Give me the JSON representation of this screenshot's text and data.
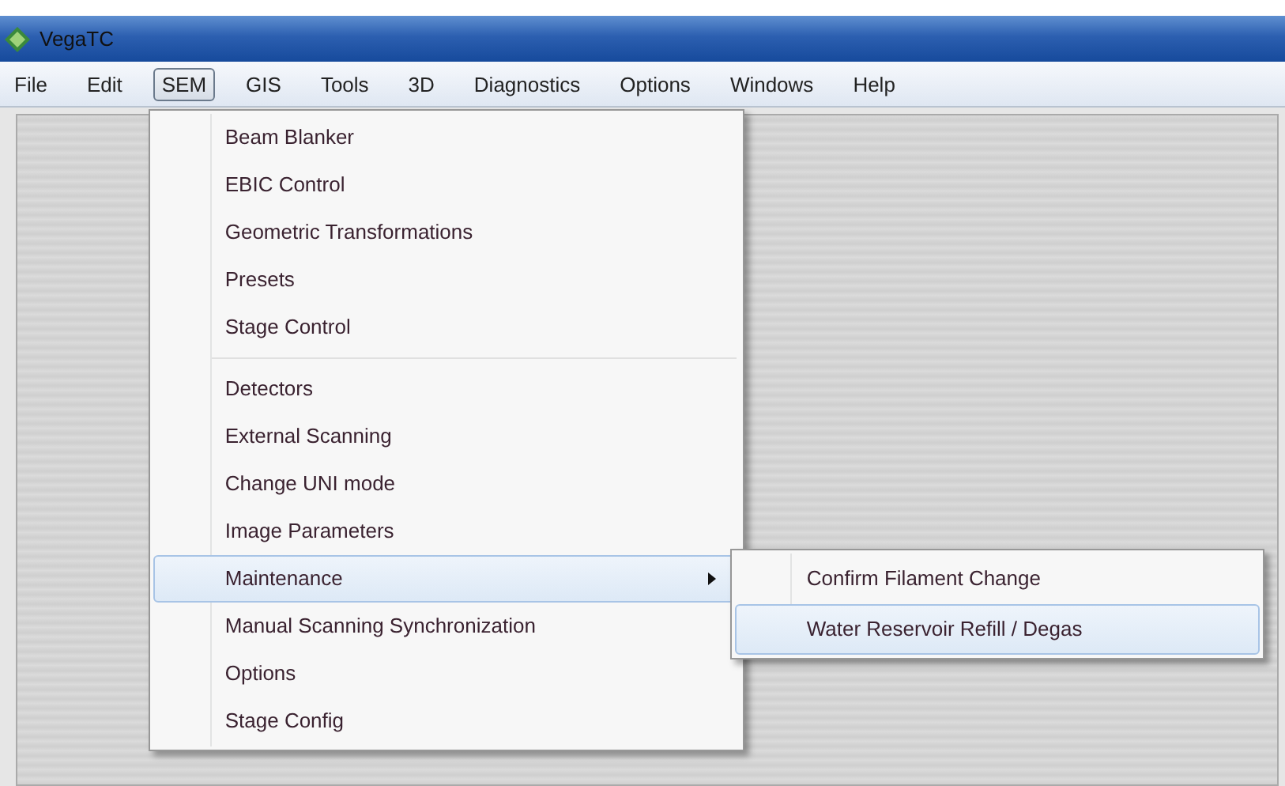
{
  "window": {
    "title": "VegaTC"
  },
  "menu_bar": [
    {
      "label": "File",
      "selected": false
    },
    {
      "label": "Edit",
      "selected": false
    },
    {
      "label": "SEM",
      "selected": true
    },
    {
      "label": "GIS",
      "selected": false
    },
    {
      "label": "Tools",
      "selected": false
    },
    {
      "label": "3D",
      "selected": false
    },
    {
      "label": "Diagnostics",
      "selected": false
    },
    {
      "label": "Options",
      "selected": false
    },
    {
      "label": "Windows",
      "selected": false
    },
    {
      "label": "Help",
      "selected": false
    }
  ],
  "dropdown": {
    "groups": [
      [
        {
          "label": "Beam Blanker",
          "selected": false
        },
        {
          "label": "EBIC Control",
          "selected": false
        },
        {
          "label": "Geometric Transformations",
          "selected": false
        },
        {
          "label": "Presets",
          "selected": false
        },
        {
          "label": "Stage Control",
          "selected": false
        }
      ],
      [
        {
          "label": "Detectors",
          "selected": false
        },
        {
          "label": "External Scanning",
          "selected": false
        },
        {
          "label": "Change UNI mode",
          "selected": false
        },
        {
          "label": "Image Parameters",
          "selected": false
        },
        {
          "label": "Maintenance",
          "selected": true,
          "submenu": [
            {
              "label": "Confirm Filament Change",
              "selected": false
            },
            {
              "label": "Water Reservoir Refill / Degas",
              "selected": true
            }
          ]
        },
        {
          "label": "Manual Scanning Synchronization",
          "selected": false
        },
        {
          "label": "Options",
          "selected": false
        },
        {
          "label": "Stage Config",
          "selected": false
        }
      ]
    ]
  }
}
